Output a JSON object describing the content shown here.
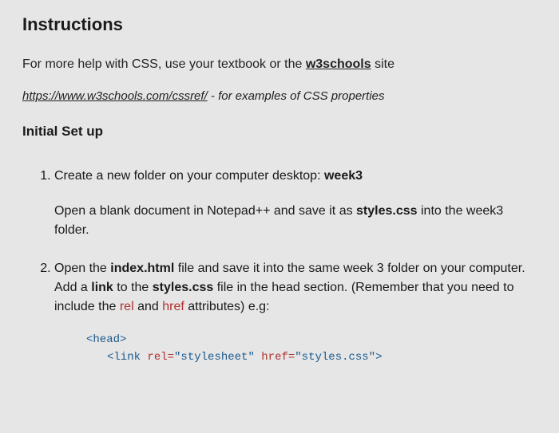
{
  "heading1": "Instructions",
  "intro_prefix": "For more help with CSS, use your textbook or the ",
  "intro_link": "w3schools",
  "intro_suffix": " site",
  "url": "https://www.w3schools.com/cssref/",
  "url_suffix": " - for examples of CSS properties",
  "heading2": "Initial Set up",
  "step1_prefix": "Create a new folder on your computer desktop: ",
  "step1_bold": "week3",
  "step1_sub_a": "Open a blank document in Notepad++ and save it as ",
  "step1_sub_bold": "styles.css",
  "step1_sub_b": " into the week3 folder.",
  "step2_a": "Open the ",
  "step2_b1": "index.html",
  "step2_c": " file and save it into the same week 3 folder on your computer. Add a ",
  "step2_b2": "link",
  "step2_d": " to the ",
  "step2_b3": "styles.css",
  "step2_e": " file in the head section. (Remember that you need to include the ",
  "step2_rel": "rel",
  "step2_f": " and ",
  "step2_href": "href",
  "step2_g": " attributes) e.g:",
  "code_line1": "<head>",
  "code_line2_open": "<link ",
  "code_line2_attr1_name": "rel=",
  "code_line2_attr1_val": "\"stylesheet\"",
  "code_line2_gap": " ",
  "code_line2_attr2_name": "href=",
  "code_line2_attr2_val": "\"styles.css\"",
  "code_line2_close": ">"
}
